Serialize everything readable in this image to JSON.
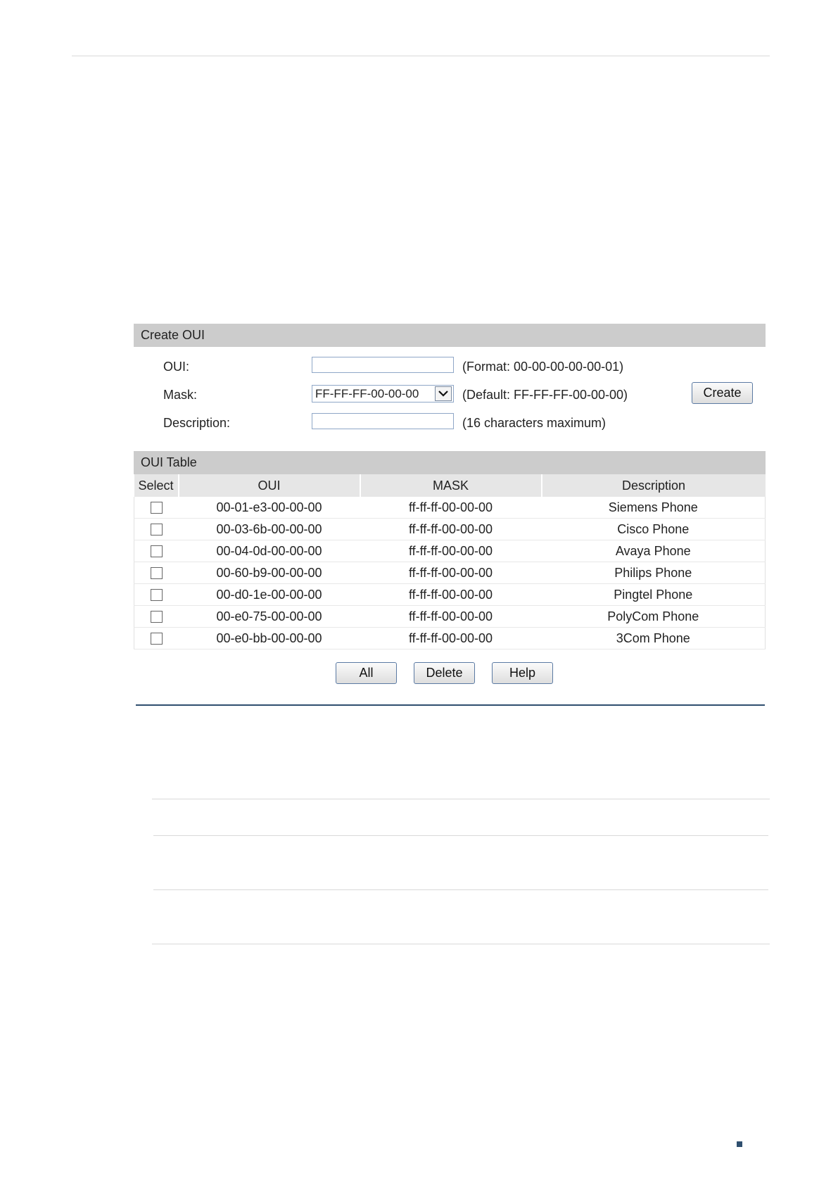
{
  "create_oui": {
    "header": "Create OUI",
    "oui_label": "OUI:",
    "oui_value": "",
    "oui_hint": "(Format: 00-00-00-00-00-01)",
    "mask_label": "Mask:",
    "mask_value": "FF-FF-FF-00-00-00",
    "mask_hint": "(Default: FF-FF-FF-00-00-00)",
    "description_label": "Description:",
    "description_value": "",
    "description_hint": "(16 characters maximum)",
    "create_label": "Create"
  },
  "oui_table": {
    "header": "OUI Table",
    "columns": [
      "Select",
      "OUI",
      "MASK",
      "Description"
    ],
    "rows": [
      {
        "oui": "00-01-e3-00-00-00",
        "mask": "ff-ff-ff-00-00-00",
        "description": "Siemens Phone",
        "selected": false
      },
      {
        "oui": "00-03-6b-00-00-00",
        "mask": "ff-ff-ff-00-00-00",
        "description": "Cisco Phone",
        "selected": false
      },
      {
        "oui": "00-04-0d-00-00-00",
        "mask": "ff-ff-ff-00-00-00",
        "description": "Avaya Phone",
        "selected": false
      },
      {
        "oui": "00-60-b9-00-00-00",
        "mask": "ff-ff-ff-00-00-00",
        "description": "Philips Phone",
        "selected": false
      },
      {
        "oui": "00-d0-1e-00-00-00",
        "mask": "ff-ff-ff-00-00-00",
        "description": "Pingtel Phone",
        "selected": false
      },
      {
        "oui": "00-e0-75-00-00-00",
        "mask": "ff-ff-ff-00-00-00",
        "description": "PolyCom Phone",
        "selected": false
      },
      {
        "oui": "00-e0-bb-00-00-00",
        "mask": "ff-ff-ff-00-00-00",
        "description": "3Com Phone",
        "selected": false
      }
    ]
  },
  "buttons": {
    "all_label": "All",
    "delete_label": "Delete",
    "help_label": "Help"
  },
  "colors": {
    "header_bg": "#cccccc",
    "column_header_bg": "#e6e6e6",
    "rule_blue": "#2f4f6f"
  }
}
